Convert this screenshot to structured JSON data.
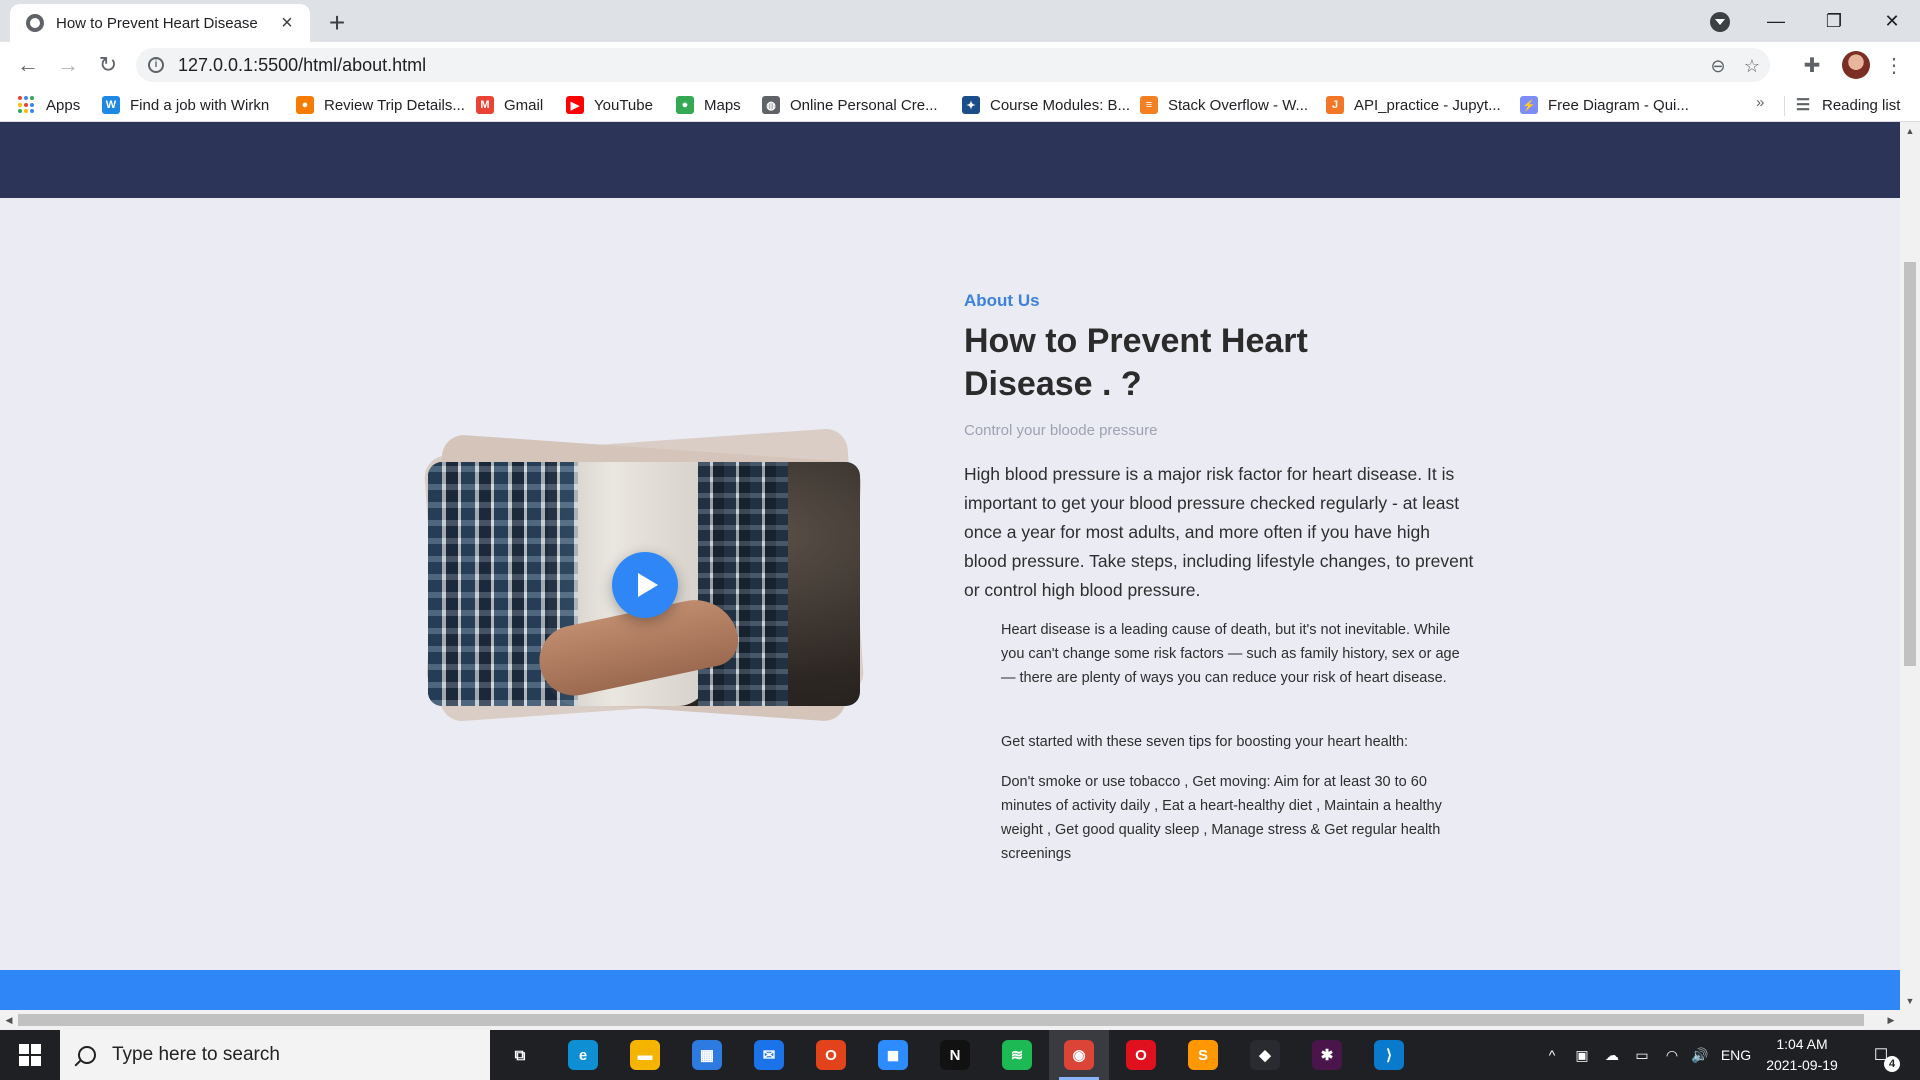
{
  "browser": {
    "tab_title": "How to Prevent Heart Disease",
    "tab_close_icon": "×",
    "new_tab_icon": "+",
    "url": "127.0.0.1:5500/html/about.html",
    "back_icon": "←",
    "forward_icon": "→",
    "reload_icon": "↻",
    "zoom_icon": "⊖",
    "star_icon": "☆",
    "extensions_icon": "✚",
    "menu_icon": "⋮",
    "minimize_icon": "—",
    "restore_icon": "❐",
    "close_window_icon": "✕"
  },
  "bookmarks": {
    "items": [
      {
        "label": "Apps",
        "icon": "apps-grid-icon"
      },
      {
        "label": "Find a job with Wirkn",
        "icon": "wirkn-icon",
        "glyph": "W",
        "color": "#1e88e5"
      },
      {
        "label": "Review Trip Details...",
        "icon": "map-pin-icon",
        "glyph": "●",
        "color": "#f57c00"
      },
      {
        "label": "Gmail",
        "icon": "gmail-icon",
        "glyph": "M",
        "color": "#ea4335"
      },
      {
        "label": "YouTube",
        "icon": "youtube-icon",
        "glyph": "▶",
        "color": "#ff0000"
      },
      {
        "label": "Maps",
        "icon": "maps-icon",
        "glyph": "●",
        "color": "#34a853"
      },
      {
        "label": "Online Personal Cre...",
        "icon": "globe-icon",
        "glyph": "◍",
        "color": "#5f6368"
      },
      {
        "label": "Course Modules: B...",
        "icon": "course-icon",
        "glyph": "✦",
        "color": "#1a4e8a"
      },
      {
        "label": "Stack Overflow - W...",
        "icon": "stackoverflow-icon",
        "glyph": "≡",
        "color": "#f48024"
      },
      {
        "label": "API_practice - Jupyt...",
        "icon": "jupyter-icon",
        "glyph": "J",
        "color": "#f37626"
      },
      {
        "label": "Free Diagram - Qui...",
        "icon": "diagram-icon",
        "glyph": "⚡",
        "color": "#7c8cf8"
      }
    ],
    "more_icon": "»",
    "reading_list": "Reading list",
    "reading_list_icon": "☰"
  },
  "about": {
    "eyebrow": "About Us",
    "headline": "How to Prevent Heart Disease . ?",
    "subhead": "Control your bloode pressure",
    "lead": "High blood pressure is a major risk factor for heart disease. It is important to get your blood pressure checked regularly - at least once a year for most adults, and more often if you have high blood pressure. Take steps, including lifestyle changes, to prevent or control high blood pressure.",
    "paragraph_1": "Heart disease is a leading cause of death, but it's not inevitable. While you can't change some risk factors — such as family history, sex or age — there are plenty of ways you can reduce your risk of heart disease.",
    "paragraph_2": "Get started with these seven tips for boosting your heart health:",
    "paragraph_3": "Don't smoke or use tobacco , Get moving: Aim for at least 30 to 60 minutes of activity daily , Eat a heart-healthy diet , Maintain a healthy weight , Get good quality sleep , Manage stress & Get regular health screenings"
  },
  "taskbar": {
    "search_placeholder": "Type here to search",
    "apps": [
      {
        "name": "task-view-icon",
        "glyph": "⧉",
        "color": "#1f2024"
      },
      {
        "name": "edge-icon",
        "glyph": "e",
        "color": "#0f8fd3"
      },
      {
        "name": "file-explorer-icon",
        "glyph": "▬",
        "color": "#f4b400"
      },
      {
        "name": "store-icon",
        "glyph": "▦",
        "color": "#2d7be0"
      },
      {
        "name": "mail-icon",
        "glyph": "✉",
        "color": "#1a73e8"
      },
      {
        "name": "office-icon",
        "glyph": "O",
        "color": "#e3431a"
      },
      {
        "name": "zoom-icon",
        "glyph": "◼",
        "color": "#2d8cff"
      },
      {
        "name": "netflix-icon",
        "glyph": "N",
        "color": "#111111"
      },
      {
        "name": "spotify-icon",
        "glyph": "≋",
        "color": "#1db954"
      },
      {
        "name": "chrome-icon",
        "glyph": "◉",
        "color": "#db4437",
        "active": true
      },
      {
        "name": "opera-icon",
        "glyph": "O",
        "color": "#e0101f"
      },
      {
        "name": "sublime-icon",
        "glyph": "S",
        "color": "#ff9800"
      },
      {
        "name": "alienware-icon",
        "glyph": "◆",
        "color": "#2a2b30"
      },
      {
        "name": "slack-icon",
        "glyph": "✱",
        "color": "#4a154b"
      },
      {
        "name": "vscode-icon",
        "glyph": "⟩",
        "color": "#0a7acc"
      }
    ],
    "tray_up_icon": "^",
    "meet_icon": "▣",
    "cloud_icon": "☁",
    "battery_icon": "▭",
    "wifi_icon": "◠",
    "volume_icon": "🔊",
    "language": "ENG",
    "time": "1:04 AM",
    "date": "2021-09-19",
    "notifications_icon": "☐",
    "notification_count": "4"
  }
}
